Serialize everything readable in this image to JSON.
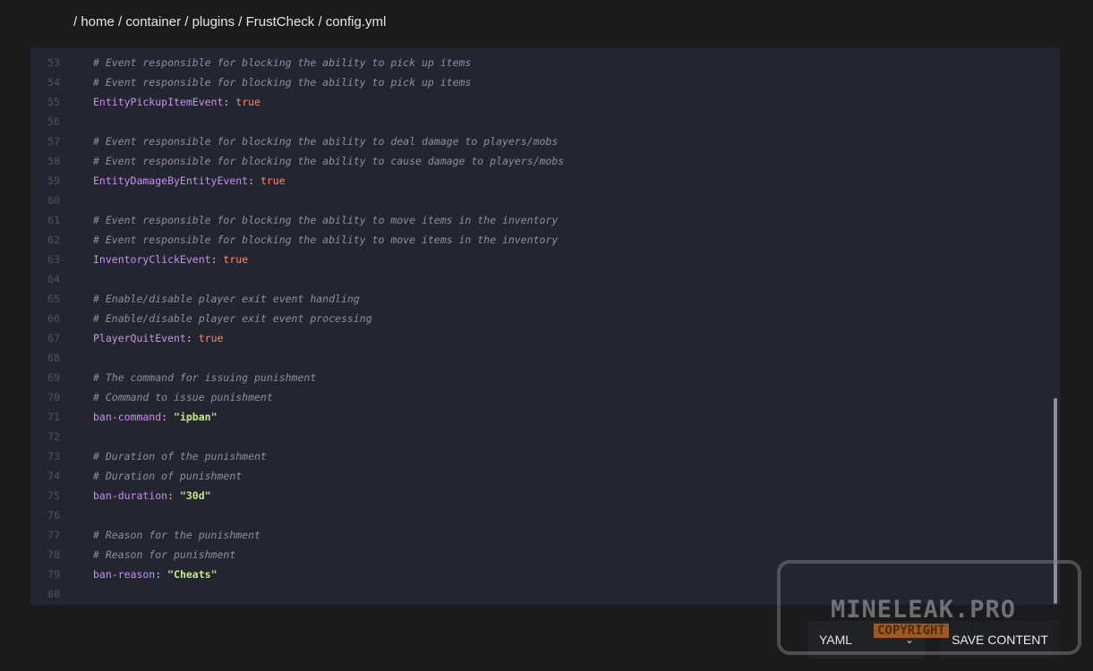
{
  "breadcrumb": "/ home / container / plugins / FrustCheck / config.yml",
  "editor": {
    "lines": [
      {
        "n": "53",
        "type": "comment",
        "text": "# Event responsible for blocking the ability to pick up items"
      },
      {
        "n": "54",
        "type": "comment",
        "text": "# Event responsible for blocking the ability to pick up items"
      },
      {
        "n": "55",
        "type": "kv",
        "key": "EntityPickupItemEvent",
        "sep": ": ",
        "value": "true",
        "vtype": "bool"
      },
      {
        "n": "56",
        "type": "blank"
      },
      {
        "n": "57",
        "type": "comment",
        "text": "# Event responsible for blocking the ability to deal damage to players/mobs"
      },
      {
        "n": "58",
        "type": "comment",
        "text": "# Event responsible for blocking the ability to cause damage to players/mobs"
      },
      {
        "n": "59",
        "type": "kv",
        "key": "EntityDamageByEntityEvent",
        "sep": ": ",
        "value": "true",
        "vtype": "bool"
      },
      {
        "n": "60",
        "type": "blank"
      },
      {
        "n": "61",
        "type": "comment",
        "text": "# Event responsible for blocking the ability to move items in the inventory"
      },
      {
        "n": "62",
        "type": "comment",
        "text": "# Event responsible for blocking the ability to move items in the inventory"
      },
      {
        "n": "63",
        "type": "kv",
        "key": "InventoryClickEvent",
        "sep": ": ",
        "value": "true",
        "vtype": "bool"
      },
      {
        "n": "64",
        "type": "blank"
      },
      {
        "n": "65",
        "type": "comment",
        "text": "# Enable/disable player exit event handling"
      },
      {
        "n": "66",
        "type": "comment",
        "text": "# Enable/disable player exit event processing"
      },
      {
        "n": "67",
        "type": "kv",
        "key": "PlayerQuitEvent",
        "sep": ": ",
        "value": "true",
        "vtype": "bool"
      },
      {
        "n": "68",
        "type": "blank"
      },
      {
        "n": "69",
        "type": "comment",
        "text": "# The command for issuing punishment"
      },
      {
        "n": "70",
        "type": "comment",
        "text": "# Command to issue punishment"
      },
      {
        "n": "71",
        "type": "kv",
        "key": "ban-command",
        "sep": ": ",
        "value": "\"ipban\"",
        "vtype": "str"
      },
      {
        "n": "72",
        "type": "blank"
      },
      {
        "n": "73",
        "type": "comment",
        "text": "# Duration of the punishment"
      },
      {
        "n": "74",
        "type": "comment",
        "text": "# Duration of punishment"
      },
      {
        "n": "75",
        "type": "kv",
        "key": "ban-duration",
        "sep": ": ",
        "value": "\"30d\"",
        "vtype": "str"
      },
      {
        "n": "76",
        "type": "blank"
      },
      {
        "n": "77",
        "type": "comment",
        "text": "# Reason for the punishment"
      },
      {
        "n": "78",
        "type": "comment",
        "text": "# Reason for punishment"
      },
      {
        "n": "79",
        "type": "kv",
        "key": "ban-reason",
        "sep": ": ",
        "value": "\"Cheats\"",
        "vtype": "str"
      },
      {
        "n": "80",
        "type": "blank"
      }
    ]
  },
  "footer": {
    "language": "YAML",
    "save_label": "SAVE CONTENT"
  },
  "watermark": {
    "title": "MINELEAK.PRO",
    "subtitle": "COPYRIGHT"
  },
  "colors": {
    "background": "#1b1b1c",
    "editor_bg": "#232631",
    "comment": "#8b8f9e",
    "key": "#c792ea",
    "bool": "#f78c6c",
    "string": "#c3e88d"
  },
  "icons": {
    "language_dropdown": "chevron-down-icon"
  }
}
